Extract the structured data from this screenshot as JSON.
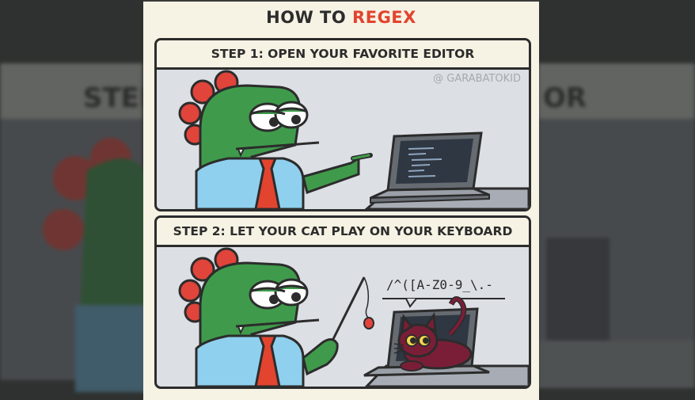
{
  "title": {
    "prefix": "HOW TO",
    "accent": "REGEX"
  },
  "watermark": "@ GARABATOKID",
  "panels": [
    {
      "step": "STEP 1: OPEN YOUR FAVORITE EDITOR"
    },
    {
      "step": "STEP 2: LET YOUR CAT PLAY ON YOUR KEYBOARD",
      "speech": "/^([A-Z0-9_\\.-"
    }
  ],
  "colors": {
    "accent": "#e2442f",
    "dino_green": "#3f9b4b",
    "dino_spikes": "#e0443a",
    "shirt": "#8fd0ee",
    "tie": "#e2442f",
    "cat": "#7a1e38",
    "panel_bg": "#dcdfe4",
    "paper": "#f6f3e4"
  }
}
